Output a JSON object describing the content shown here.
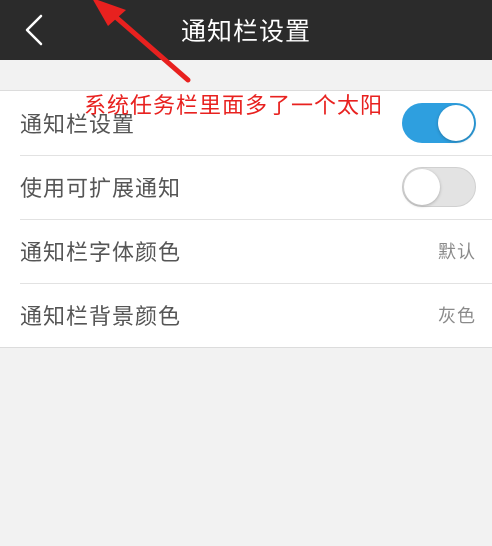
{
  "header": {
    "title": "通知栏设置"
  },
  "settings": {
    "items": [
      {
        "label": "通知栏设置",
        "control": "toggle",
        "state": "on"
      },
      {
        "label": "使用可扩展通知",
        "control": "toggle",
        "state": "off"
      },
      {
        "label": "通知栏字体颜色",
        "control": "value",
        "value": "默认"
      },
      {
        "label": "通知栏背景颜色",
        "control": "value",
        "value": "灰色"
      }
    ]
  },
  "annotation": {
    "text": "系统任务栏里面多了一个太阳",
    "color": "#e8211f"
  },
  "colors": {
    "header_bg": "#2b2b2b",
    "toggle_on": "#2e9fdf",
    "toggle_off": "#e3e3e3",
    "page_bg": "#f2f2f2"
  },
  "icons": {
    "back": "chevron-left-icon"
  }
}
